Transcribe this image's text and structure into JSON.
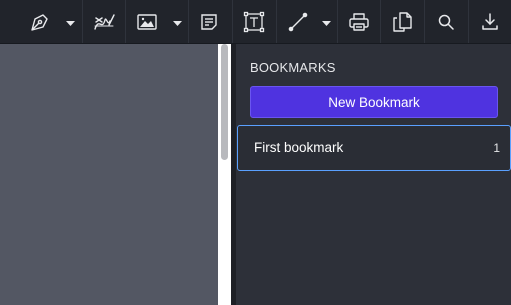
{
  "toolbar": {
    "tools": [
      {
        "name": "pen-tool",
        "icon": "pen-nib-icon",
        "has_dropdown": true
      },
      {
        "name": "signature-tool",
        "icon": "signature-icon",
        "has_dropdown": false
      },
      {
        "name": "image-tool",
        "icon": "image-icon",
        "has_dropdown": true
      },
      {
        "name": "note-tool",
        "icon": "note-icon",
        "has_dropdown": false
      },
      {
        "name": "text-box-tool",
        "icon": "text-box-icon",
        "has_dropdown": false
      },
      {
        "name": "line-tool",
        "icon": "line-icon",
        "has_dropdown": true
      },
      {
        "name": "print-button",
        "icon": "printer-icon",
        "has_dropdown": false
      },
      {
        "name": "duplicate-button",
        "icon": "copy-icon",
        "has_dropdown": false
      },
      {
        "name": "search-button",
        "icon": "search-icon",
        "has_dropdown": false
      },
      {
        "name": "download-button",
        "icon": "download-icon",
        "has_dropdown": false
      }
    ]
  },
  "panel": {
    "title": "BOOKMARKS",
    "new_button_label": "New Bookmark",
    "bookmarks": [
      {
        "label": "First bookmark",
        "page": "1"
      }
    ]
  },
  "colors": {
    "toolbar_bg": "#21242b",
    "panel_bg": "#2d3039",
    "accent": "#4f33e0",
    "selection_border": "#5aa0ff",
    "document_bg": "#535763"
  }
}
